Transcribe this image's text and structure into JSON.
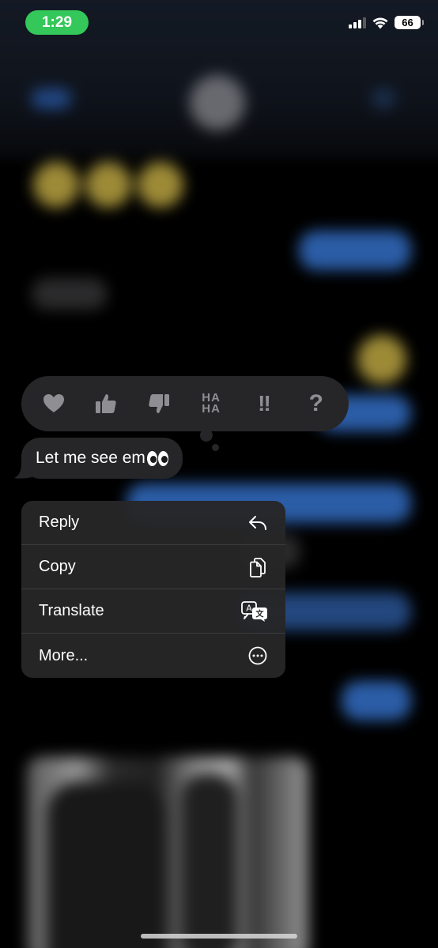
{
  "status_bar": {
    "time": "1:29",
    "battery": "66"
  },
  "tapbacks": [
    {
      "name": "heart-icon"
    },
    {
      "name": "thumbs-up-icon"
    },
    {
      "name": "thumbs-down-icon"
    },
    {
      "name": "haha-icon",
      "line1": "HA",
      "line2": "HA"
    },
    {
      "name": "exclamation-icon",
      "label": "!!"
    },
    {
      "name": "question-icon",
      "label": "?"
    }
  ],
  "message": {
    "text": "Let me see em"
  },
  "menu": {
    "items": [
      {
        "label": "Reply",
        "icon": "reply-icon"
      },
      {
        "label": "Copy",
        "icon": "copy-icon"
      },
      {
        "label": "Translate",
        "icon": "translate-icon"
      },
      {
        "label": "More...",
        "icon": "more-icon"
      }
    ]
  },
  "colors": {
    "time_pill": "#34c759",
    "bubble": "#262628",
    "icon_grey": "#8e8e93"
  }
}
